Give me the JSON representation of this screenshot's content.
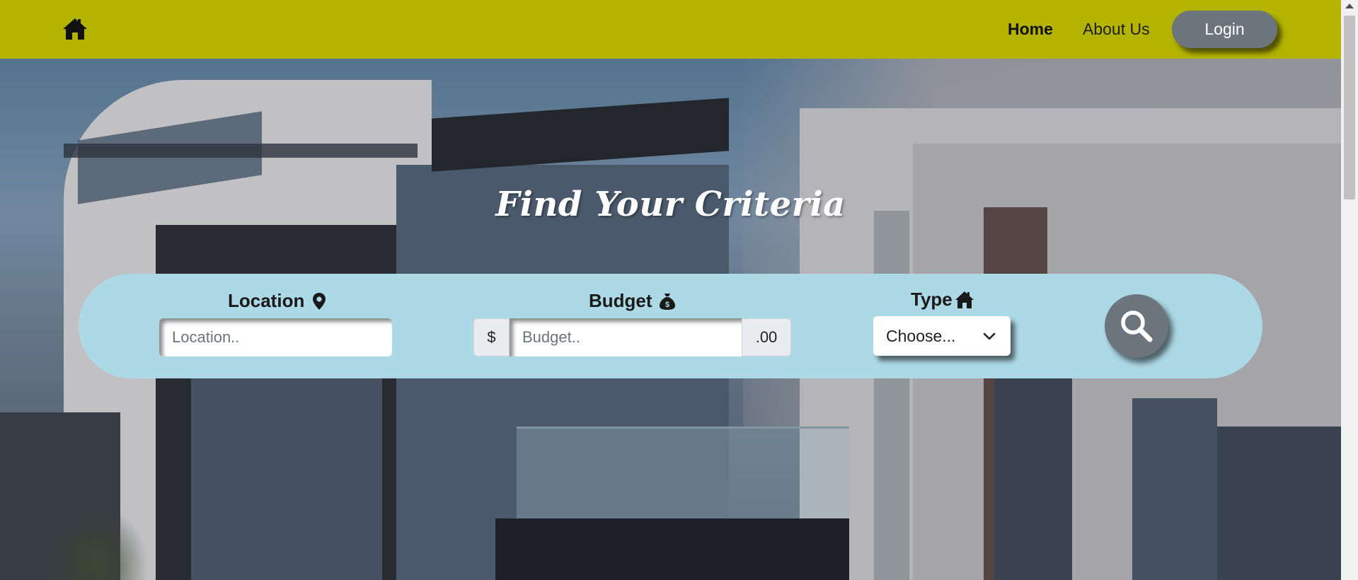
{
  "navbar": {
    "home_icon": "home-icon",
    "links": [
      {
        "label": "Home",
        "active": true
      },
      {
        "label": "About Us",
        "active": false
      }
    ],
    "login_label": "Login",
    "background_color": "#b3b300",
    "login_color": "#6c757d"
  },
  "hero": {
    "title": "Find Your Criteria"
  },
  "search": {
    "background_color": "#add8e6",
    "location": {
      "label": "Location",
      "icon": "map-pin-icon",
      "placeholder": "Location.."
    },
    "budget": {
      "label": "Budget",
      "icon": "money-bag-icon",
      "prefix": "$",
      "placeholder": "Budget..",
      "suffix": ".00"
    },
    "type": {
      "label": "Type",
      "icon": "home-icon",
      "selected": "Choose..."
    },
    "submit_icon": "search-icon"
  }
}
